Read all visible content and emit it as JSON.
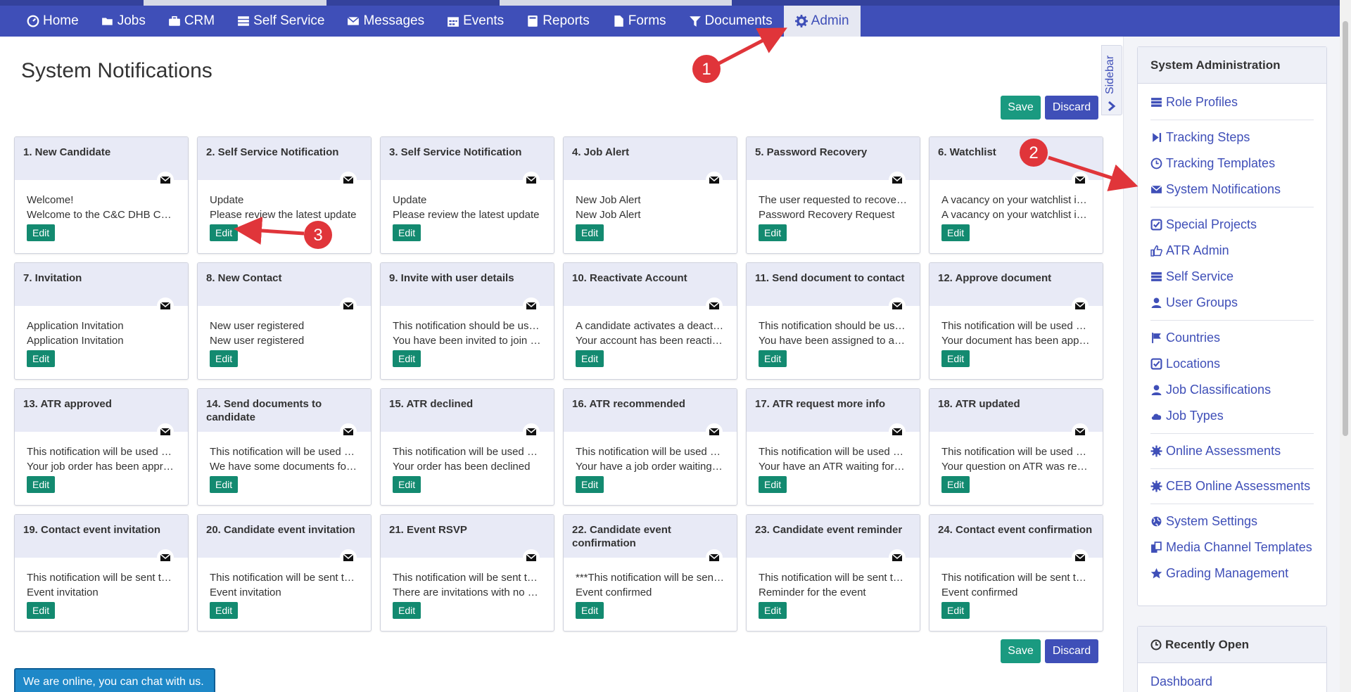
{
  "nav": {
    "items": [
      {
        "label": "Home",
        "icon": "dashboard-icon"
      },
      {
        "label": "Jobs",
        "icon": "folder-open-icon"
      },
      {
        "label": "CRM",
        "icon": "briefcase-icon"
      },
      {
        "label": "Self Service",
        "icon": "server-icon"
      },
      {
        "label": "Messages",
        "icon": "envelope-icon"
      },
      {
        "label": "Events",
        "icon": "calendar-icon"
      },
      {
        "label": "Reports",
        "icon": "book-icon"
      },
      {
        "label": "Forms",
        "icon": "file-icon"
      },
      {
        "label": "Documents",
        "icon": "filter-icon"
      },
      {
        "label": "Admin",
        "icon": "gear-icon",
        "active": true
      }
    ]
  },
  "page": {
    "title": "System Notifications",
    "save_label": "Save",
    "discard_label": "Discard"
  },
  "sidebar_tab": {
    "label": "Sidebar"
  },
  "cards": [
    {
      "title": "1. New Candidate",
      "line1": "Welcome!",
      "line2": "Welcome to the C&C DHB Career Portal",
      "edit": "Edit"
    },
    {
      "title": "2. Self Service Notification",
      "line1": "Update",
      "line2": "Please review the latest update",
      "edit": "Edit"
    },
    {
      "title": "3. Self Service Notification",
      "line1": "Update",
      "line2": "Please review the latest update",
      "edit": "Edit"
    },
    {
      "title": "4. Job Alert",
      "line1": "New Job Alert",
      "line2": "New Job Alert",
      "edit": "Edit"
    },
    {
      "title": "5. Password Recovery",
      "line1": "The user requested to recover the password",
      "line2": "Password Recovery Request",
      "edit": "Edit"
    },
    {
      "title": "6. Watchlist",
      "line1": "A vacancy on your watchlist is closing",
      "line2": "A vacancy on your watchlist is closing",
      "edit": "Edit"
    },
    {
      "title": "7. Invitation",
      "line1": "Application Invitation",
      "line2": "Application Invitation",
      "edit": "Edit"
    },
    {
      "title": "8. New Contact",
      "line1": "New user registered",
      "line2": "New user registered",
      "edit": "Edit"
    },
    {
      "title": "9. Invite with user details",
      "line1": "This notification should be used when",
      "line2": "You have been invited to join the portal",
      "edit": "Edit"
    },
    {
      "title": "10. Reactivate Account",
      "line1": "A candidate activates a deactivated account",
      "line2": "Your account has been reactivated",
      "edit": "Edit"
    },
    {
      "title": "11. Send document to contact",
      "line1": "This notification should be used when",
      "line2": "You have been assigned to a document",
      "edit": "Edit"
    },
    {
      "title": "12. Approve document",
      "line1": "This notification will be used when",
      "line2": "Your document has been approved",
      "edit": "Edit"
    },
    {
      "title": "13. ATR approved",
      "line1": "This notification will be used when",
      "line2": "Your job order has been approved",
      "edit": "Edit"
    },
    {
      "title": "14. Send documents to candidate",
      "line1": "This notification will be used when",
      "line2": "We have some documents for you",
      "edit": "Edit"
    },
    {
      "title": "15. ATR declined",
      "line1": "This notification will be used when",
      "line2": "Your order has been declined",
      "edit": "Edit"
    },
    {
      "title": "16. ATR recommended",
      "line1": "This notification will be used when",
      "line2": "Your have a job order waiting for you",
      "edit": "Edit"
    },
    {
      "title": "17. ATR request more info",
      "line1": "This notification will be used when",
      "line2": "Your have an ATR waiting for you",
      "edit": "Edit"
    },
    {
      "title": "18. ATR updated",
      "line1": "This notification will be used when",
      "line2": "Your question on ATR was responded",
      "edit": "Edit"
    },
    {
      "title": "19. Contact event invitation",
      "line1": "This notification will be sent to contacts",
      "line2": "Event invitation",
      "edit": "Edit"
    },
    {
      "title": "20. Candidate event invitation",
      "line1": "This notification will be sent to candidates",
      "line2": "Event invitation",
      "edit": "Edit"
    },
    {
      "title": "21. Event RSVP",
      "line1": "This notification will be sent to the owner",
      "line2": "There are invitations with no response",
      "edit": "Edit"
    },
    {
      "title": "22. Candidate event confirmation",
      "line1": "***This notification will be sent to candidates",
      "line2": "Event confirmed",
      "edit": "Edit"
    },
    {
      "title": "23. Candidate event reminder",
      "line1": "This notification will be sent to candidates",
      "line2": "Reminder for the event",
      "edit": "Edit"
    },
    {
      "title": "24. Contact event confirmation",
      "line1": "This notification will be sent to contacts",
      "line2": "Event confirmed",
      "edit": "Edit"
    }
  ],
  "admin_panel": {
    "title": "System Administration",
    "items": [
      {
        "label": "Role Profiles",
        "icon": "server-icon"
      },
      {
        "sep": true
      },
      {
        "label": "Tracking Steps",
        "icon": "step-forward-icon"
      },
      {
        "label": "Tracking Templates",
        "icon": "clock-icon"
      },
      {
        "label": "System Notifications",
        "icon": "envelope-icon"
      },
      {
        "sep": true
      },
      {
        "label": "Special Projects",
        "icon": "check-square-icon"
      },
      {
        "label": "ATR Admin",
        "icon": "thumbs-up-icon"
      },
      {
        "label": "Self Service",
        "icon": "server-icon"
      },
      {
        "label": "User Groups",
        "icon": "user-icon"
      },
      {
        "sep": true
      },
      {
        "label": "Countries",
        "icon": "flag-icon"
      },
      {
        "label": "Locations",
        "icon": "check-square-icon"
      },
      {
        "label": "Job Classifications",
        "icon": "user-icon"
      },
      {
        "label": "Job Types",
        "icon": "cloud-icon"
      },
      {
        "sep": true
      },
      {
        "label": "Online Assessments",
        "icon": "certificate-icon"
      },
      {
        "sep": true
      },
      {
        "label": "CEB Online Assessments",
        "icon": "certificate-icon"
      },
      {
        "sep": true
      },
      {
        "label": "System Settings",
        "icon": "globe-icon"
      },
      {
        "label": "Media Channel Templates",
        "icon": "copy-icon"
      },
      {
        "label": "Grading Management",
        "icon": "star-icon"
      }
    ]
  },
  "recent_panel": {
    "title": "Recently Open",
    "item": "Dashboard"
  },
  "chat": {
    "label": "We are online, you can chat with us."
  },
  "annotations": [
    "1",
    "2",
    "3"
  ],
  "colors": {
    "nav_bg": "#3f4fb8",
    "save": "#1a9a80",
    "edit": "#138a70",
    "annotation": "#e0353a",
    "link": "#3f4fb8"
  }
}
